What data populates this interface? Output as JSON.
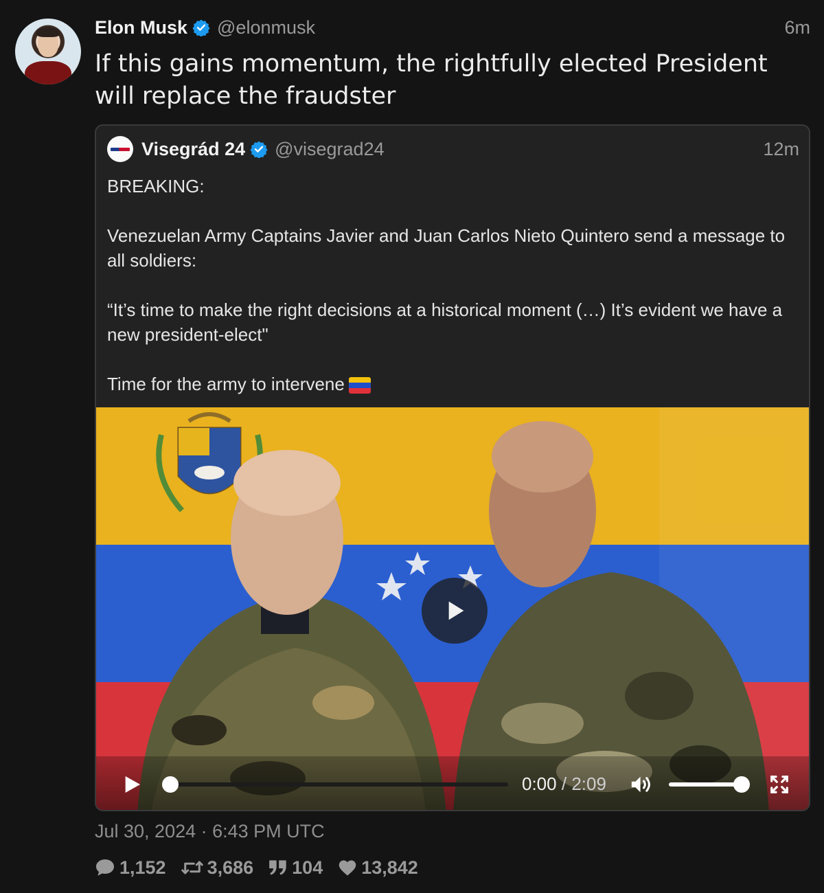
{
  "tweet": {
    "author_name": "Elon Musk",
    "author_handle": "@elonmusk",
    "time": "6m",
    "text": "If this gains momentum, the rightfully elected President will replace the fraudster",
    "date": "Jul 30, 2024 · 6:43 PM UTC"
  },
  "quote": {
    "author_name": "Visegrád 24",
    "author_handle": "@visegrad24",
    "time": "12m",
    "paragraphs": [
      "BREAKING:",
      "Venezuelan Army Captains Javier and Juan Carlos Nieto Quintero send a message to all soldiers:",
      "“It’s time to make the right decisions at a historical moment (…) It’s evident we have a new president-elect\"",
      "Time for the army to intervene"
    ]
  },
  "video": {
    "current_time": "0:00",
    "separator": "/",
    "duration": "2:09",
    "progress": 0,
    "volume": 1
  },
  "stats": {
    "replies": "1,152",
    "retweets": "3,686",
    "quotes": "104",
    "likes": "13,842"
  },
  "icons": {
    "verified": "verified-badge-icon",
    "reply": "speech-bubble-icon",
    "retweet": "retweet-arrows-icon",
    "quote": "quote-marks-icon",
    "like": "heart-icon"
  },
  "colors": {
    "verified_blue": "#1d9bf0",
    "flag_yellow": "#f4c20d",
    "flag_blue": "#1f4fc8",
    "flag_red": "#e0313a"
  }
}
